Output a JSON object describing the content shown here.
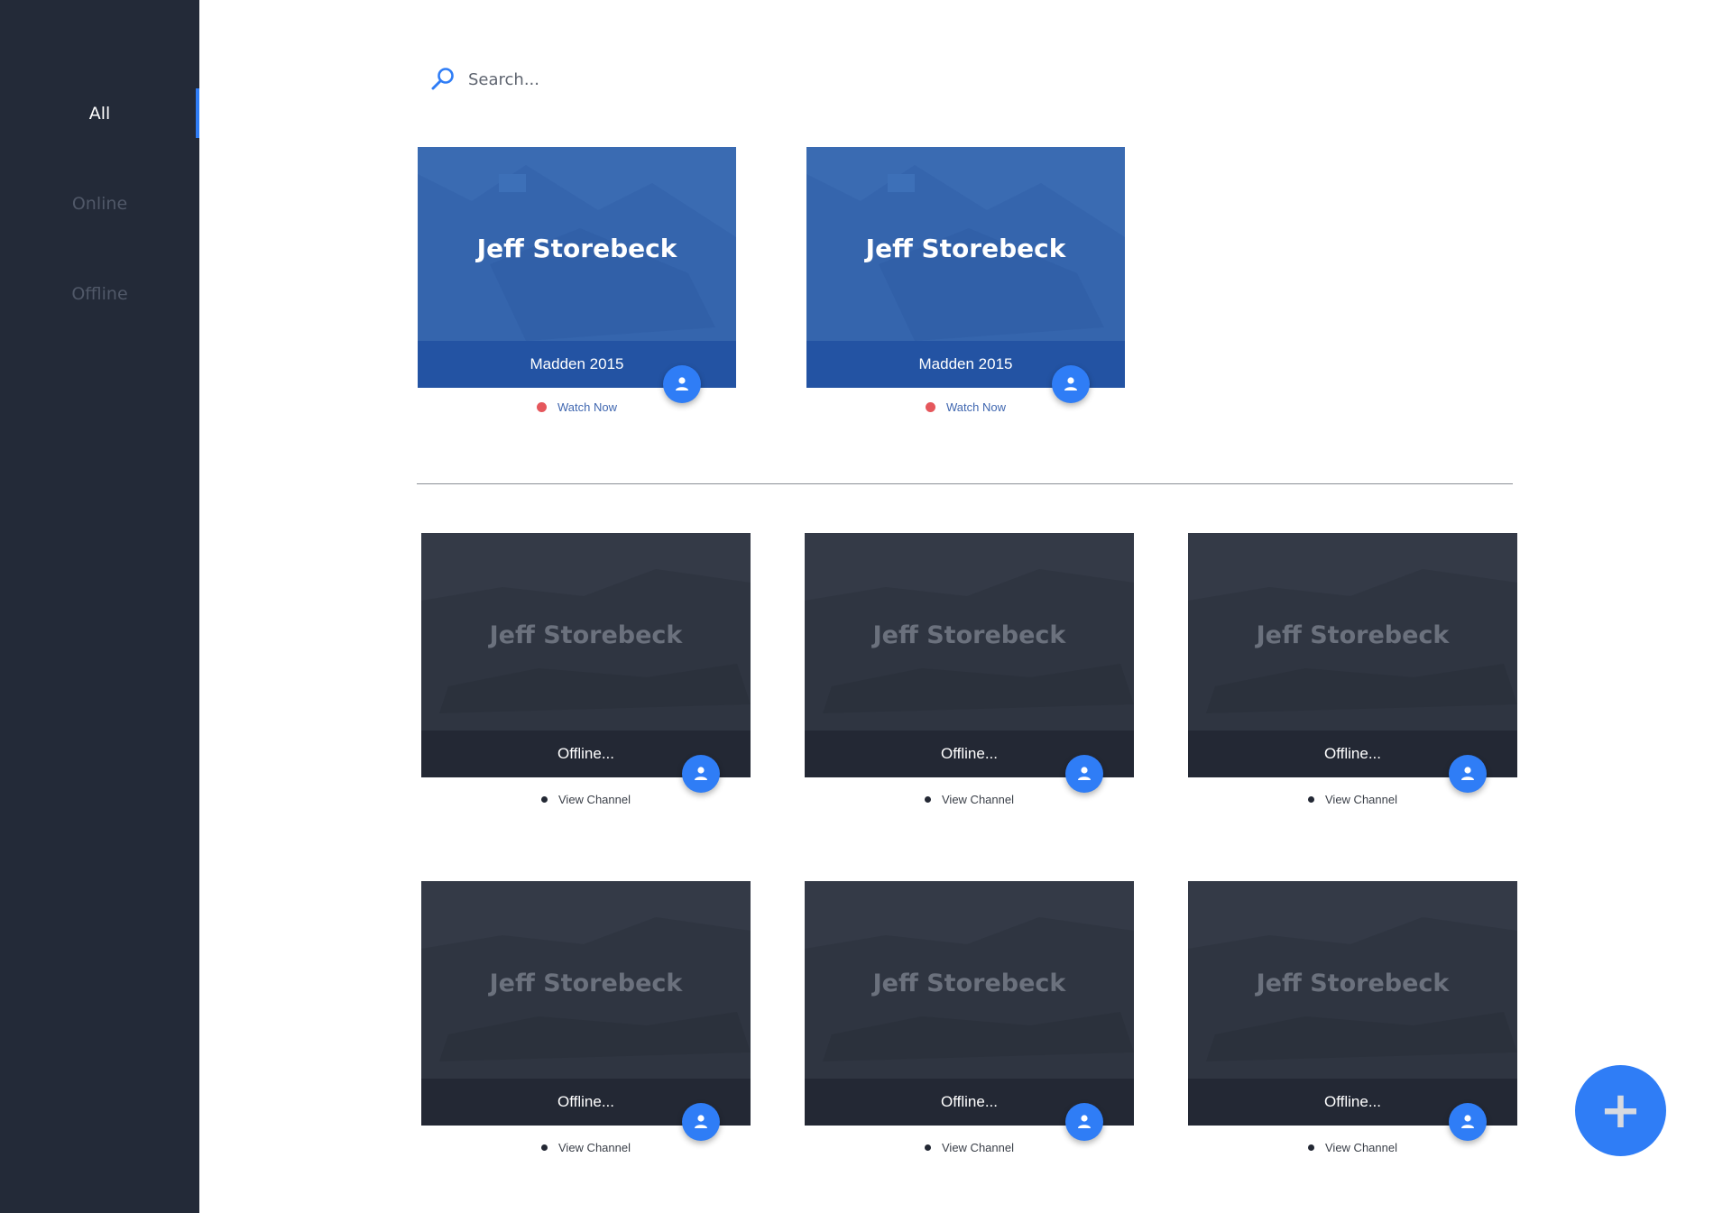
{
  "sidebar": {
    "items": [
      {
        "label": "All",
        "active": true
      },
      {
        "label": "Online",
        "active": false
      },
      {
        "label": "Offline",
        "active": false
      }
    ]
  },
  "search": {
    "placeholder": "Search...",
    "icon": "search-icon"
  },
  "online_cards": [
    {
      "name": "Jeff Storebeck",
      "game": "Madden 2015",
      "link": "Watch Now",
      "status_color": "#e5575c"
    },
    {
      "name": "Jeff Storebeck",
      "game": "Madden 2015",
      "link": "Watch Now",
      "status_color": "#e5575c"
    }
  ],
  "offline_cards": [
    {
      "name": "Jeff Storebeck",
      "status": "Offline...",
      "link": "View Channel"
    },
    {
      "name": "Jeff Storebeck",
      "status": "Offline...",
      "link": "View Channel"
    },
    {
      "name": "Jeff Storebeck",
      "status": "Offline...",
      "link": "View Channel"
    },
    {
      "name": "Jeff Storebeck",
      "status": "Offline...",
      "link": "View Channel"
    },
    {
      "name": "Jeff Storebeck",
      "status": "Offline...",
      "link": "View Channel"
    },
    {
      "name": "Jeff Storebeck",
      "status": "Offline...",
      "link": "View Channel"
    }
  ],
  "fab": {
    "label": "+",
    "icon": "plus-icon"
  },
  "colors": {
    "sidebar_bg": "#232a38",
    "accent": "#2f7df6",
    "live_card": "#3565ad",
    "offline_card": "#343a47",
    "live_dot": "#e5575c"
  }
}
